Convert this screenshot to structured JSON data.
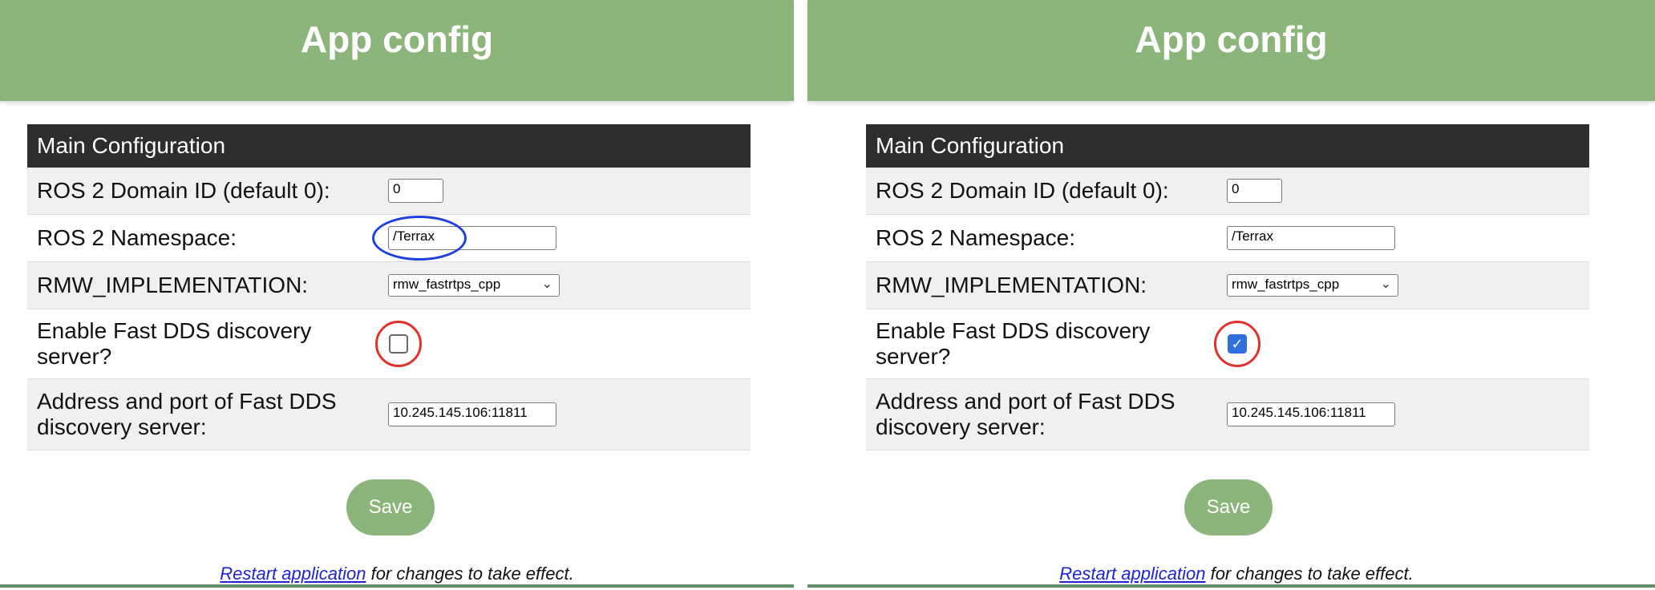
{
  "panels": [
    {
      "header_title": "App config",
      "section_title": "Main Configuration",
      "domain_id_label": "ROS 2 Domain ID (default 0):",
      "domain_id_value": "0",
      "namespace_label": "ROS 2 Namespace:",
      "namespace_value": "/Terrax",
      "rmw_label": "RMW_IMPLEMENTATION:",
      "rmw_value": "rmw_fastrtps_cpp",
      "discovery_enable_label_line1": "Enable Fast DDS discovery",
      "discovery_enable_label_line2": "server?",
      "discovery_enabled": false,
      "discovery_address_label_line1": "Address and port of Fast DDS",
      "discovery_address_label_line2": "discovery server:",
      "discovery_address_value": "10.245.145.106:11811",
      "save_label": "Save",
      "restart_link": "Restart application",
      "restart_suffix": " for changes to take effect."
    },
    {
      "header_title": "App config",
      "section_title": "Main Configuration",
      "domain_id_label": "ROS 2 Domain ID (default 0):",
      "domain_id_value": "0",
      "namespace_label": "ROS 2 Namespace:",
      "namespace_value": "/Terrax",
      "rmw_label": "RMW_IMPLEMENTATION:",
      "rmw_value": "rmw_fastrtps_cpp",
      "discovery_enable_label_line1": "Enable Fast DDS discovery",
      "discovery_enable_label_line2": "server?",
      "discovery_enabled": true,
      "discovery_address_label_line1": "Address and port of Fast DDS",
      "discovery_address_label_line2": "discovery server:",
      "discovery_address_value": "10.245.145.106:11811",
      "save_label": "Save",
      "restart_link": "Restart application",
      "restart_suffix": " for changes to take effect."
    }
  ],
  "icons": {
    "dropdown": "chevron-down-icon",
    "checkmark": "check-icon"
  },
  "colors": {
    "header_bg": "#8bb57b",
    "section_bg": "#2d2d2d",
    "annotation_red": "#e0312a",
    "annotation_blue": "#1c3fe0",
    "checkbox_checked": "#2f6fe0",
    "link": "#1f23d6"
  }
}
